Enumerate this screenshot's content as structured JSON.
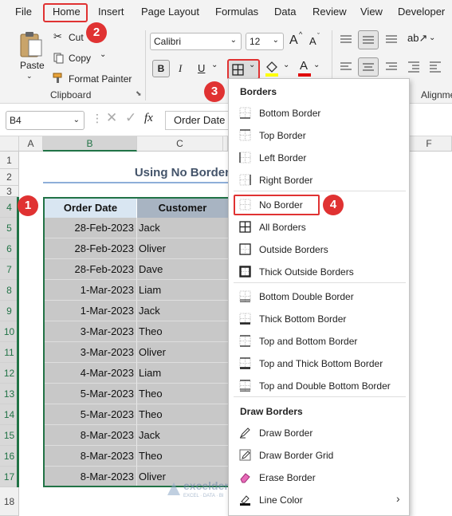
{
  "menu": [
    "File",
    "Home",
    "Insert",
    "Page Layout",
    "Formulas",
    "Data",
    "Review",
    "View",
    "Developer"
  ],
  "ribbon": {
    "paste_label": "Paste",
    "cut_label": "Cut",
    "copy_label": "Copy",
    "format_painter_label": "Format Painter",
    "clipboard_group": "Clipboard",
    "font_name": "Calibri",
    "font_size": "12",
    "bold": "B",
    "italic": "I",
    "underline": "U",
    "font_color_glyph": "A",
    "grow_font_glyph": "A",
    "shrink_font_glyph": "A",
    "alignment_group": "Alignme"
  },
  "formula_bar": {
    "name_box": "B4",
    "fx": "fx",
    "content": "Order Date"
  },
  "grid": {
    "columns": [
      "A",
      "B",
      "C",
      "F"
    ],
    "rows": [
      "1",
      "2",
      "3",
      "4",
      "5",
      "6",
      "7",
      "8",
      "9",
      "10",
      "11",
      "12",
      "13",
      "14",
      "15",
      "16",
      "17",
      "18"
    ],
    "title": "Using No Border",
    "headers": [
      "Order Date",
      "Customer"
    ],
    "data": [
      [
        "28-Feb-2023",
        "Jack"
      ],
      [
        "28-Feb-2023",
        "Oliver"
      ],
      [
        "28-Feb-2023",
        "Dave"
      ],
      [
        "1-Mar-2023",
        "Liam"
      ],
      [
        "1-Mar-2023",
        "Jack"
      ],
      [
        "3-Mar-2023",
        "Theo"
      ],
      [
        "3-Mar-2023",
        "Oliver"
      ],
      [
        "4-Mar-2023",
        "Liam"
      ],
      [
        "5-Mar-2023",
        "Theo"
      ],
      [
        "5-Mar-2023",
        "Theo"
      ],
      [
        "8-Mar-2023",
        "Jack"
      ],
      [
        "8-Mar-2023",
        "Theo"
      ],
      [
        "8-Mar-2023",
        "Oliver"
      ]
    ]
  },
  "dropdown": {
    "borders_header": "Borders",
    "items": [
      "Bottom Border",
      "Top Border",
      "Left Border",
      "Right Border",
      "No Border",
      "All Borders",
      "Outside Borders",
      "Thick Outside Borders",
      "Bottom Double Border",
      "Thick Bottom Border",
      "Top and Bottom Border",
      "Top and Thick Bottom Border",
      "Top and Double Bottom Border"
    ],
    "draw_header": "Draw Borders",
    "draw_items": [
      "Draw Border",
      "Draw Border Grid",
      "Erase Border",
      "Line Color"
    ]
  },
  "badges": [
    "1",
    "2",
    "3",
    "4"
  ],
  "watermark": {
    "name": "exceldemy",
    "tagline": "EXCEL · DATA · BI"
  },
  "colors": {
    "accent_red": "#e03232",
    "selection_green": "#217346",
    "header_fill": "#d9e6f2",
    "cell_fill": "#c8c8c8",
    "title_color": "#44546a"
  }
}
